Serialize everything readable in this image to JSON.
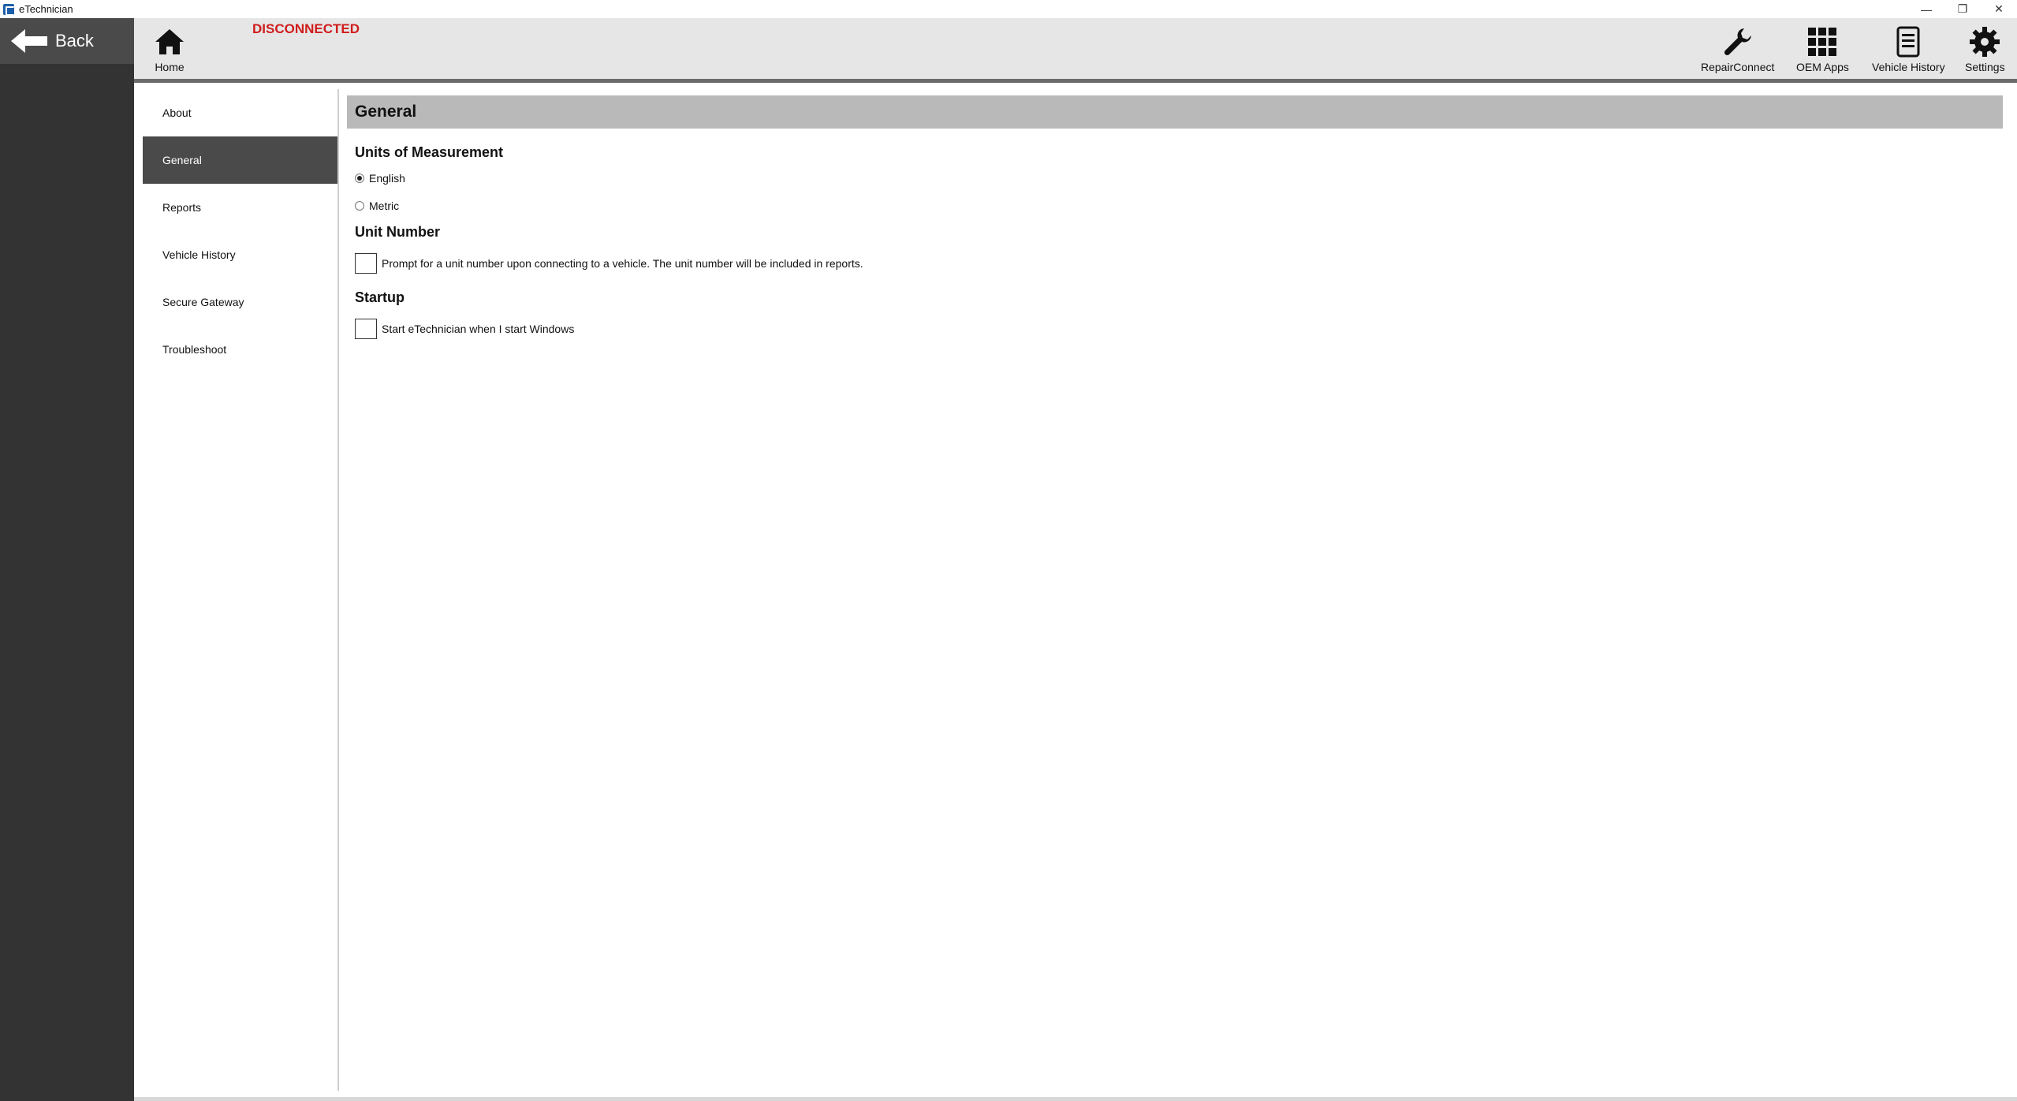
{
  "window": {
    "title": "eTechnician",
    "controls": {
      "minimize": "—",
      "restore": "❐",
      "close": "✕"
    }
  },
  "back_button": {
    "label": "Back"
  },
  "connection_status": "DISCONNECTED",
  "toolbar": {
    "home": "Home",
    "repair_connect": "RepairConnect",
    "oem_apps": "OEM Apps",
    "vehicle_history": "Vehicle History",
    "settings": "Settings"
  },
  "nav": {
    "items": [
      {
        "label": "About"
      },
      {
        "label": "General",
        "active": true
      },
      {
        "label": "Reports"
      },
      {
        "label": "Vehicle History"
      },
      {
        "label": "Secure Gateway"
      },
      {
        "label": "Troubleshoot"
      }
    ]
  },
  "general": {
    "header": "General",
    "units": {
      "title": "Units of Measurement",
      "options": [
        {
          "label": "English",
          "selected": true
        },
        {
          "label": "Metric",
          "selected": false
        }
      ]
    },
    "unit_number": {
      "title": "Unit Number",
      "checkbox_label": "Prompt for a unit number upon connecting to a vehicle. The unit number will be included in reports.",
      "checked": false
    },
    "startup": {
      "title": "Startup",
      "checkbox_label": "Start eTechnician when I start Windows",
      "checked": false
    }
  },
  "colors": {
    "status": "#d01c1c",
    "rail": "#333333",
    "active_nav": "#4a4a4a",
    "section_header": "#b9b9b9"
  }
}
